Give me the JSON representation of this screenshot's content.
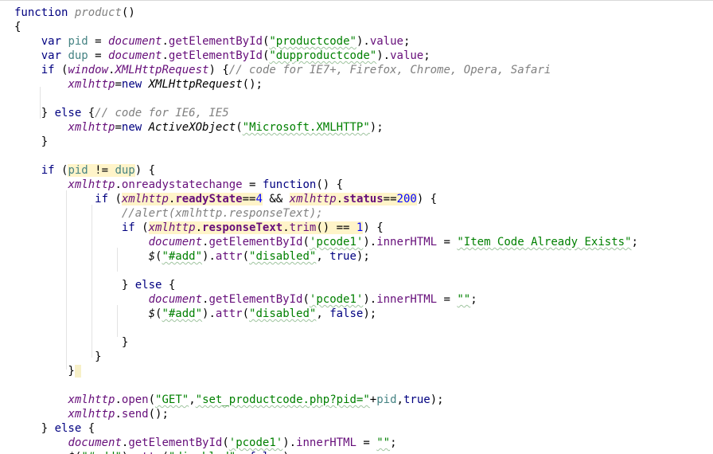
{
  "editor": {
    "lines": [
      {
        "segments": [
          [
            "kw",
            "function"
          ],
          [
            "op",
            " "
          ],
          [
            "decl-italic",
            "product"
          ],
          [
            "op",
            "()"
          ]
        ]
      },
      {
        "segments": [
          [
            "op",
            "{"
          ]
        ]
      },
      {
        "segments": [
          [
            "op",
            "    "
          ],
          [
            "kw",
            "var"
          ],
          [
            "op",
            " "
          ],
          [
            "var",
            "pid"
          ],
          [
            "op",
            " = "
          ],
          [
            "gvar",
            "document"
          ],
          [
            "op",
            "."
          ],
          [
            "prop",
            "getElementById"
          ],
          [
            "op",
            "("
          ],
          [
            "str",
            "\"productcode\""
          ],
          [
            "op",
            ")."
          ],
          [
            "prop",
            "value"
          ],
          [
            "op",
            ";"
          ]
        ]
      },
      {
        "segments": [
          [
            "op",
            "    "
          ],
          [
            "kw",
            "var"
          ],
          [
            "op",
            " "
          ],
          [
            "var",
            "dup"
          ],
          [
            "op",
            " = "
          ],
          [
            "gvar",
            "document"
          ],
          [
            "op",
            "."
          ],
          [
            "prop",
            "getElementById"
          ],
          [
            "op",
            "("
          ],
          [
            "str",
            "\"dupproductcode\""
          ],
          [
            "op",
            ")."
          ],
          [
            "prop",
            "value"
          ],
          [
            "op",
            ";"
          ]
        ]
      },
      {
        "segments": [
          [
            "op",
            "    "
          ],
          [
            "kw",
            "if"
          ],
          [
            "op",
            " ("
          ],
          [
            "gvar",
            "window"
          ],
          [
            "op",
            "."
          ],
          [
            "gvar",
            "XMLHttpRequest"
          ],
          [
            "op",
            ") {"
          ],
          [
            "cmt",
            "// code for IE7+, Firefox, Chrome, Opera, Safari"
          ]
        ]
      },
      {
        "segments": [
          [
            "op",
            "        "
          ],
          [
            "gvar",
            "xmlhttp"
          ],
          [
            "op",
            "="
          ],
          [
            "kw",
            "new"
          ],
          [
            "op",
            " "
          ],
          [
            "fn-italic",
            "XMLHttpRequest"
          ],
          [
            "op",
            "();"
          ]
        ]
      },
      {
        "segments": [
          [
            "op",
            ""
          ]
        ]
      },
      {
        "segments": [
          [
            "op",
            "    } "
          ],
          [
            "kw",
            "else"
          ],
          [
            "op",
            " {"
          ],
          [
            "cmt",
            "// code for IE6, IE5"
          ]
        ]
      },
      {
        "segments": [
          [
            "op",
            "        "
          ],
          [
            "gvar",
            "xmlhttp"
          ],
          [
            "op",
            "="
          ],
          [
            "kw",
            "new"
          ],
          [
            "op",
            " "
          ],
          [
            "fn-italic",
            "ActiveXObject"
          ],
          [
            "op",
            "("
          ],
          [
            "str",
            "\"Microsoft.XMLHTTP\""
          ],
          [
            "op",
            ");"
          ]
        ]
      },
      {
        "segments": [
          [
            "op",
            "    }"
          ]
        ]
      },
      {
        "segments": [
          [
            "op",
            ""
          ]
        ]
      },
      {
        "segments": [
          [
            "op",
            "    "
          ],
          [
            "kw",
            "if"
          ],
          [
            "op",
            " ("
          ],
          [
            "hl-var",
            "pid"
          ],
          [
            "hl-op",
            " != "
          ],
          [
            "hl-var",
            "dup"
          ],
          [
            "op",
            ") {"
          ]
        ]
      },
      {
        "segments": [
          [
            "op",
            "        "
          ],
          [
            "gvar",
            "xmlhttp"
          ],
          [
            "op",
            "."
          ],
          [
            "prop",
            "onreadystatechange"
          ],
          [
            "op",
            " = "
          ],
          [
            "kw",
            "function"
          ],
          [
            "op",
            "() {"
          ]
        ]
      },
      {
        "segments": [
          [
            "op",
            "            "
          ],
          [
            "kw",
            "if"
          ],
          [
            "op",
            " ("
          ],
          [
            "hl-gvar",
            "xmlhttp"
          ],
          [
            "hl-op",
            "."
          ],
          [
            "hl-propb",
            "readyState"
          ],
          [
            "hl-op",
            "=="
          ],
          [
            "hl-num",
            "4"
          ],
          [
            "op",
            " && "
          ],
          [
            "hl-gvar",
            "xmlhttp"
          ],
          [
            "hl-op",
            "."
          ],
          [
            "hl-propb",
            "status"
          ],
          [
            "hl-op",
            "=="
          ],
          [
            "hl-num",
            "200"
          ],
          [
            "op",
            ") {"
          ]
        ]
      },
      {
        "segments": [
          [
            "op",
            "                "
          ],
          [
            "cmt",
            "//alert(xmlhttp.responseText);"
          ]
        ]
      },
      {
        "segments": [
          [
            "op",
            "                "
          ],
          [
            "kw",
            "if"
          ],
          [
            "op",
            " ("
          ],
          [
            "hl-gvar",
            "xmlhttp"
          ],
          [
            "hl-op",
            "."
          ],
          [
            "hl-propb",
            "responseText"
          ],
          [
            "hl-op",
            "."
          ],
          [
            "hl-prop",
            "trim"
          ],
          [
            "hl-op",
            "() == "
          ],
          [
            "hl-num",
            "1"
          ],
          [
            "op",
            ") {"
          ]
        ]
      },
      {
        "segments": [
          [
            "op",
            "                    "
          ],
          [
            "gvar",
            "document"
          ],
          [
            "op",
            "."
          ],
          [
            "prop",
            "getElementById"
          ],
          [
            "op",
            "("
          ],
          [
            "sstr",
            "'pcode1'"
          ],
          [
            "op",
            ")."
          ],
          [
            "prop",
            "innerHTML"
          ],
          [
            "op",
            " = "
          ],
          [
            "str",
            "\"Item Code Already Exists\""
          ],
          [
            "op",
            ";"
          ]
        ]
      },
      {
        "segments": [
          [
            "op",
            "                    "
          ],
          [
            "fn-italic",
            "$"
          ],
          [
            "op",
            "("
          ],
          [
            "str",
            "\"#add\""
          ],
          [
            "op",
            ")."
          ],
          [
            "prop",
            "attr"
          ],
          [
            "op",
            "("
          ],
          [
            "str",
            "\"disabled\""
          ],
          [
            "op",
            ", "
          ],
          [
            "kw",
            "true"
          ],
          [
            "op",
            ");"
          ]
        ]
      },
      {
        "segments": [
          [
            "op",
            ""
          ]
        ]
      },
      {
        "segments": [
          [
            "op",
            "                } "
          ],
          [
            "kw",
            "else"
          ],
          [
            "op",
            " {"
          ]
        ]
      },
      {
        "segments": [
          [
            "op",
            "                    "
          ],
          [
            "gvar",
            "document"
          ],
          [
            "op",
            "."
          ],
          [
            "prop",
            "getElementById"
          ],
          [
            "op",
            "("
          ],
          [
            "sstr",
            "'pcode1'"
          ],
          [
            "op",
            ")."
          ],
          [
            "prop",
            "innerHTML"
          ],
          [
            "op",
            " = "
          ],
          [
            "str",
            "\"\""
          ],
          [
            "op",
            ";"
          ]
        ]
      },
      {
        "segments": [
          [
            "op",
            "                    "
          ],
          [
            "fn-italic",
            "$"
          ],
          [
            "op",
            "("
          ],
          [
            "str",
            "\"#add\""
          ],
          [
            "op",
            ")."
          ],
          [
            "prop",
            "attr"
          ],
          [
            "op",
            "("
          ],
          [
            "str",
            "\"disabled\""
          ],
          [
            "op",
            ", "
          ],
          [
            "kw",
            "false"
          ],
          [
            "op",
            ");"
          ]
        ]
      },
      {
        "segments": [
          [
            "op",
            ""
          ]
        ]
      },
      {
        "segments": [
          [
            "op",
            "                }"
          ]
        ]
      },
      {
        "segments": [
          [
            "op",
            "            }"
          ]
        ]
      },
      {
        "segments": [
          [
            "op",
            "        }"
          ],
          [
            "caret",
            " "
          ]
        ]
      },
      {
        "segments": [
          [
            "op",
            ""
          ]
        ]
      },
      {
        "segments": [
          [
            "op",
            "        "
          ],
          [
            "gvar",
            "xmlhttp"
          ],
          [
            "op",
            "."
          ],
          [
            "prop",
            "open"
          ],
          [
            "op",
            "("
          ],
          [
            "str",
            "\"GET\""
          ],
          [
            "op",
            ","
          ],
          [
            "str",
            "\"set_productcode.php?pid=\""
          ],
          [
            "op",
            "+"
          ],
          [
            "var",
            "pid"
          ],
          [
            "op",
            ","
          ],
          [
            "kw",
            "true"
          ],
          [
            "op",
            ");"
          ]
        ]
      },
      {
        "segments": [
          [
            "op",
            "        "
          ],
          [
            "gvar",
            "xmlhttp"
          ],
          [
            "op",
            "."
          ],
          [
            "prop",
            "send"
          ],
          [
            "op",
            "();"
          ]
        ]
      },
      {
        "segments": [
          [
            "op",
            "    } "
          ],
          [
            "kw",
            "else"
          ],
          [
            "op",
            " {"
          ]
        ]
      },
      {
        "segments": [
          [
            "op",
            "        "
          ],
          [
            "gvar",
            "document"
          ],
          [
            "op",
            "."
          ],
          [
            "prop",
            "getElementById"
          ],
          [
            "op",
            "("
          ],
          [
            "sstr",
            "'pcode1'"
          ],
          [
            "op",
            ")."
          ],
          [
            "prop",
            "innerHTML"
          ],
          [
            "op",
            " = "
          ],
          [
            "str",
            "\"\""
          ],
          [
            "op",
            ";"
          ]
        ]
      },
      {
        "segments": [
          [
            "op",
            "        "
          ],
          [
            "fn-italic",
            "$"
          ],
          [
            "op",
            "("
          ],
          [
            "str",
            "\"#add\""
          ],
          [
            "op",
            ")."
          ],
          [
            "prop",
            "attr"
          ],
          [
            "op",
            "("
          ],
          [
            "str",
            "\"disabled\""
          ],
          [
            "op",
            ", "
          ],
          [
            "kw",
            "false"
          ],
          [
            "op",
            ");"
          ]
        ]
      }
    ]
  }
}
